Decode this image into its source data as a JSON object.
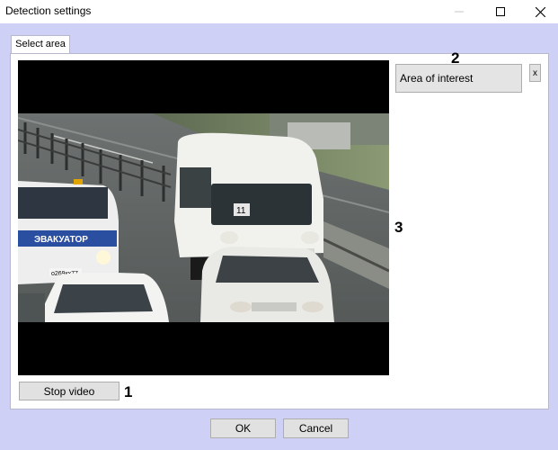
{
  "window": {
    "title": "Detection settings"
  },
  "tabs": [
    {
      "label": "Select area"
    }
  ],
  "area": {
    "label": "Area of interest",
    "remove_label": "x"
  },
  "video": {
    "stop_label": "Stop video",
    "vehicle_plate_text": "ЭВАКУАТОР",
    "plate_text": "о269кх77",
    "van_number": "11"
  },
  "callouts": {
    "one": "1",
    "two": "2",
    "three": "3"
  },
  "footer": {
    "ok_label": "OK",
    "cancel_label": "Cancel"
  }
}
